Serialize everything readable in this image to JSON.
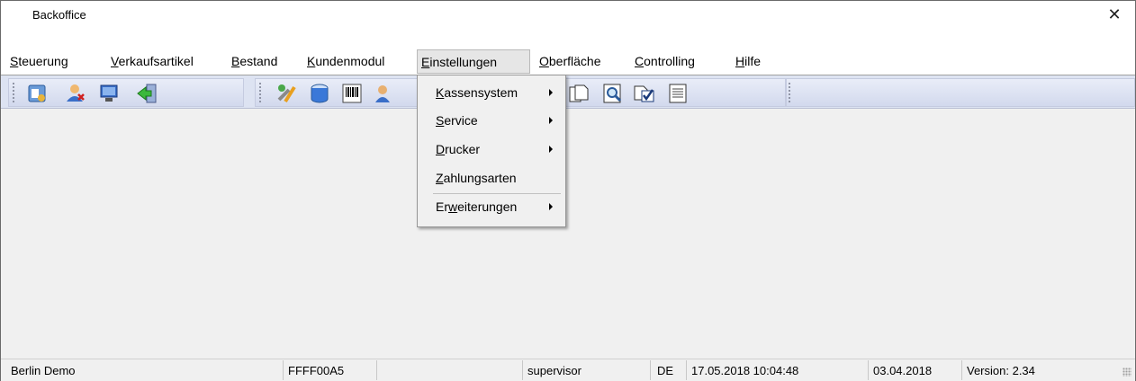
{
  "window": {
    "title": "Backoffice",
    "close_glyph": "✕"
  },
  "menubar": {
    "items": [
      {
        "accel": "S",
        "rest": "teuerung"
      },
      {
        "accel": "V",
        "rest": "erkaufsartikel"
      },
      {
        "accel": "B",
        "rest": "estand"
      },
      {
        "accel": "K",
        "rest": "undenmodul"
      },
      {
        "accel": "E",
        "rest": "instellungen"
      },
      {
        "accel": "O",
        "rest": "berfläche"
      },
      {
        "accel": "C",
        "rest": "ontrolling"
      },
      {
        "accel": "H",
        "rest": "ilfe"
      }
    ],
    "active_index": 4
  },
  "dropdown": {
    "items": [
      {
        "pre": "",
        "accel": "K",
        "rest": "assensystem",
        "submenu": true
      },
      {
        "pre": "",
        "accel": "S",
        "rest": "ervice",
        "submenu": true
      },
      {
        "pre": "",
        "accel": "D",
        "rest": "rucker",
        "submenu": true
      },
      {
        "pre": "",
        "accel": "Z",
        "rest": "ahlungsarten",
        "submenu": false
      },
      {
        "pre": "Er",
        "accel": "w",
        "rest": "eiterungen",
        "submenu": true
      }
    ]
  },
  "toolbar": {
    "icons": [
      "articles-icon",
      "users-icon",
      "monitor-icon",
      "exit-icon",
      "tools-icon",
      "database-icon",
      "barcode-icon",
      "user-icon",
      "document-icon",
      "preview-icon",
      "checklist-icon",
      "text-document-icon"
    ]
  },
  "statusbar": {
    "location": "Berlin Demo",
    "code": "FFFF00A5",
    "empty": "",
    "user": "supervisor",
    "language": "DE",
    "datetime": "17.05.2018 10:04:48",
    "date": "03.04.2018",
    "version": "Version: 2.34"
  },
  "colors": {
    "toolbar_bg": "#dde3f2",
    "menu_active_bg": "#e6e6e6",
    "window_bg": "#f0f0f0"
  }
}
